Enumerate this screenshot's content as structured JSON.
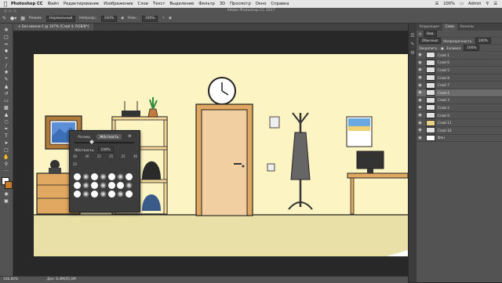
{
  "menubar": {
    "app_name": "Photoshop CC",
    "items": [
      "Файл",
      "Редактирование",
      "Изображение",
      "Слои",
      "Текст",
      "Выделение",
      "Фильтр",
      "3D",
      "Просмотр",
      "Окно",
      "Справка"
    ],
    "battery": "100%",
    "user": "Admin"
  },
  "window": {
    "title": "Adobe Photoshop CC 2017"
  },
  "options": {
    "mode_label": "Режим:",
    "mode_value": "Нормальный",
    "opacity_label": "Непрозр.:",
    "opacity_value": "100%",
    "flow_label": "Наж.:",
    "flow_value": "100%"
  },
  "document": {
    "tab_title": "Без имени-1 @ 107% (Слой 4, RGB/8*)"
  },
  "status": {
    "zoom": "106,84%",
    "doc_info": "Док: 6,4М/45,0М"
  },
  "panels": {
    "tabs": [
      "Коррекция",
      "Слои",
      "Каналы"
    ],
    "active_tab": "Слои",
    "filter_label": "Вид",
    "blend_value": "Обычные",
    "opacity_label": "Непрозрачность:",
    "opacity_value": "100%",
    "lock_label": "Закрепить:",
    "fill_label": "Заливка:",
    "fill_value": "100%",
    "layers": [
      "Слой 1",
      "Слой 6",
      "Слой 5",
      "Слой 8",
      "Слой 7",
      "Слой 4",
      "Слой 3",
      "Слой 2",
      "Слой 9",
      "Слой 11",
      "Слой 10",
      "Фон"
    ],
    "active_layer_index": 5
  },
  "brush_panel": {
    "tabs": [
      "Размер",
      "Жёсткость"
    ],
    "active_tab": "Жёсткость",
    "hardness_label": "Жёсткость:",
    "hardness_value": "100%",
    "size_value": "25",
    "preset_labels": [
      "30",
      "30",
      "25",
      "25",
      "25",
      "36"
    ]
  },
  "colors": {
    "wall": "#fdf4c4",
    "floor": "#e8e0a6",
    "door": "#f2cfa0",
    "ui_dark": "#535353",
    "selected_layer": "#6b6b6b"
  }
}
